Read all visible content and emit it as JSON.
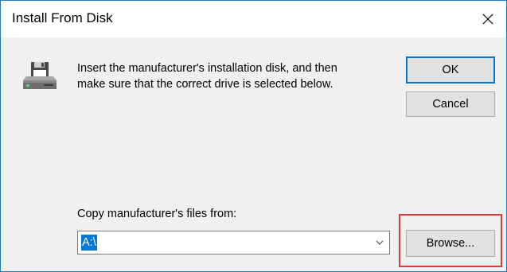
{
  "window": {
    "title": "Install From Disk"
  },
  "instructions": {
    "line1": "Insert the manufacturer's installation disk, and then",
    "line2": "make sure that the correct drive is selected below."
  },
  "buttons": {
    "ok": "OK",
    "cancel": "Cancel",
    "browse": "Browse..."
  },
  "copy_from": {
    "label": "Copy manufacturer's files from:",
    "value": "A:\\"
  },
  "icons": {
    "close": "close-icon",
    "disk": "floppy-disk-drive-icon",
    "dropdown": "chevron-down-icon"
  },
  "colors": {
    "accent": "#0078d7",
    "highlight_box": "#e53935",
    "window_border": "#1979ca"
  }
}
